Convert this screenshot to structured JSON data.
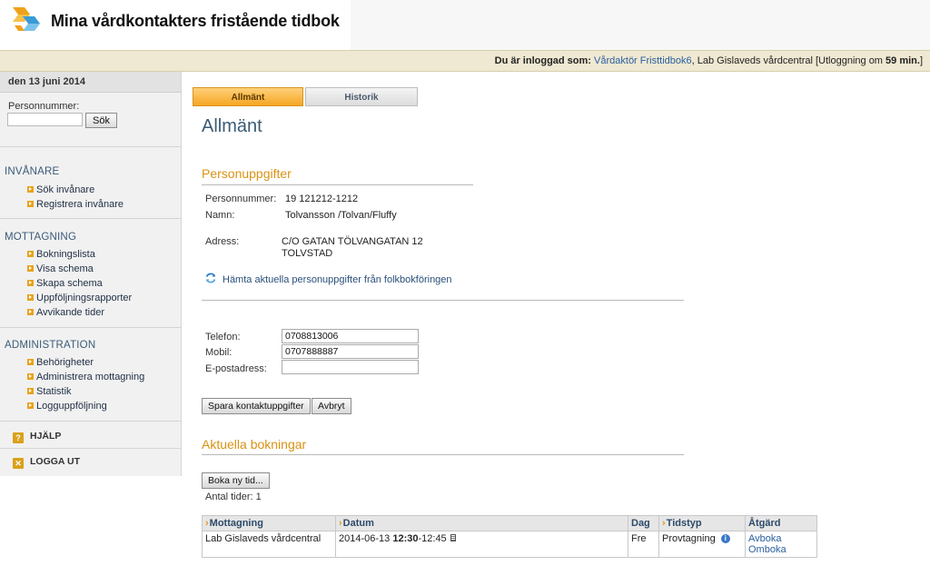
{
  "header": {
    "title": "Mina vårdkontakters fristående tidbok",
    "login_prefix": "Du är inloggad som:",
    "user_name": "Vårdaktör Fristtidbok6",
    "unit": ", Lab Gislaveds vårdcentral [Utloggning om ",
    "logout_minutes": "59 min.",
    "login_suffix": "]"
  },
  "sidebar": {
    "date": "den 13 juni 2014",
    "personnummer_label": "Personnummer:",
    "search_button": "Sök",
    "sections": [
      {
        "title": "INVÅNARE",
        "items": [
          "Sök invånare",
          "Registrera invånare"
        ]
      },
      {
        "title": "MOTTAGNING",
        "items": [
          "Bokningslista",
          "Visa schema",
          "Skapa schema",
          "Uppföljningsrapporter",
          "Avvikande tider"
        ]
      },
      {
        "title": "ADMINISTRATION",
        "items": [
          "Behörigheter",
          "Administrera mottagning",
          "Statistik",
          "Logguppföljning"
        ]
      }
    ],
    "help": "HJÄLP",
    "logout": "LOGGA UT"
  },
  "tabs": [
    "Allmänt",
    "Historik"
  ],
  "page_title": "Allmänt",
  "personal": {
    "section_title": "Personuppgifter",
    "pn_label": "Personnummer:",
    "pn_value": "19 121212-1212",
    "name_label": "Namn:",
    "name_value": "Tolvansson /Tolvan/Fluffy",
    "address_label": "Adress:",
    "address_line1": "C/O GATAN TÖLVANGATAN 12",
    "address_line2": "TOLVSTAD",
    "refresh_link": "Hämta aktuella personuppgifter från folkbokföringen"
  },
  "contact": {
    "phone_label": "Telefon:",
    "phone_value": "0708813006",
    "mobile_label": "Mobil:",
    "mobile_value": "0707888887",
    "email_label": "E-postadress:",
    "email_value": "",
    "save_button": "Spara kontaktuppgifter",
    "cancel_button": "Avbryt"
  },
  "bookings": {
    "section_title": "Aktuella bokningar",
    "new_button": "Boka ny tid...",
    "count_text": "Antal tider: 1",
    "columns": [
      "Mottagning",
      "Datum",
      "Dag",
      "Tidstyp",
      "Åtgärd"
    ],
    "rows": [
      {
        "mottagning": "Lab Gislaveds vårdcentral",
        "date": "2014-06-13",
        "start": "12:30",
        "end": "-12:45",
        "dag": "Fre",
        "tidstyp": "Provtagning",
        "action_cancel": "Avboka",
        "action_rebook": "Omboka"
      }
    ]
  },
  "colors": {
    "accent_orange": "#d99212",
    "title_blue": "#3a5b74",
    "login_bar": "#efe8d2"
  }
}
